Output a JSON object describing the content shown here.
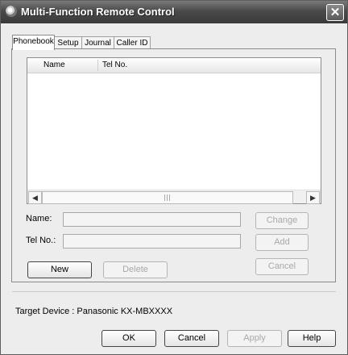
{
  "window": {
    "title": "Multi-Function Remote Control"
  },
  "tabs": [
    {
      "label": "Phonebook",
      "active": true
    },
    {
      "label": "Setup",
      "active": false
    },
    {
      "label": "Journal",
      "active": false
    },
    {
      "label": "Caller ID",
      "active": false
    }
  ],
  "phonebook": {
    "columns": [
      "Name",
      "Tel No."
    ],
    "name_label": "Name:",
    "tel_label": "Tel No.:",
    "name_value": "",
    "tel_value": "",
    "buttons": {
      "change": "Change",
      "add": "Add",
      "cancel": "Cancel",
      "new": "New",
      "delete": "Delete"
    }
  },
  "footer": {
    "target_device": "Target Device : Panasonic KX-MBXXXX",
    "buttons": {
      "ok": "OK",
      "cancel": "Cancel",
      "apply": "Apply",
      "help": "Help"
    }
  },
  "icons": {
    "app": "remote-control-icon",
    "close": "close-icon",
    "scroll_left": "arrow-left-icon",
    "scroll_right": "arrow-right-icon"
  }
}
